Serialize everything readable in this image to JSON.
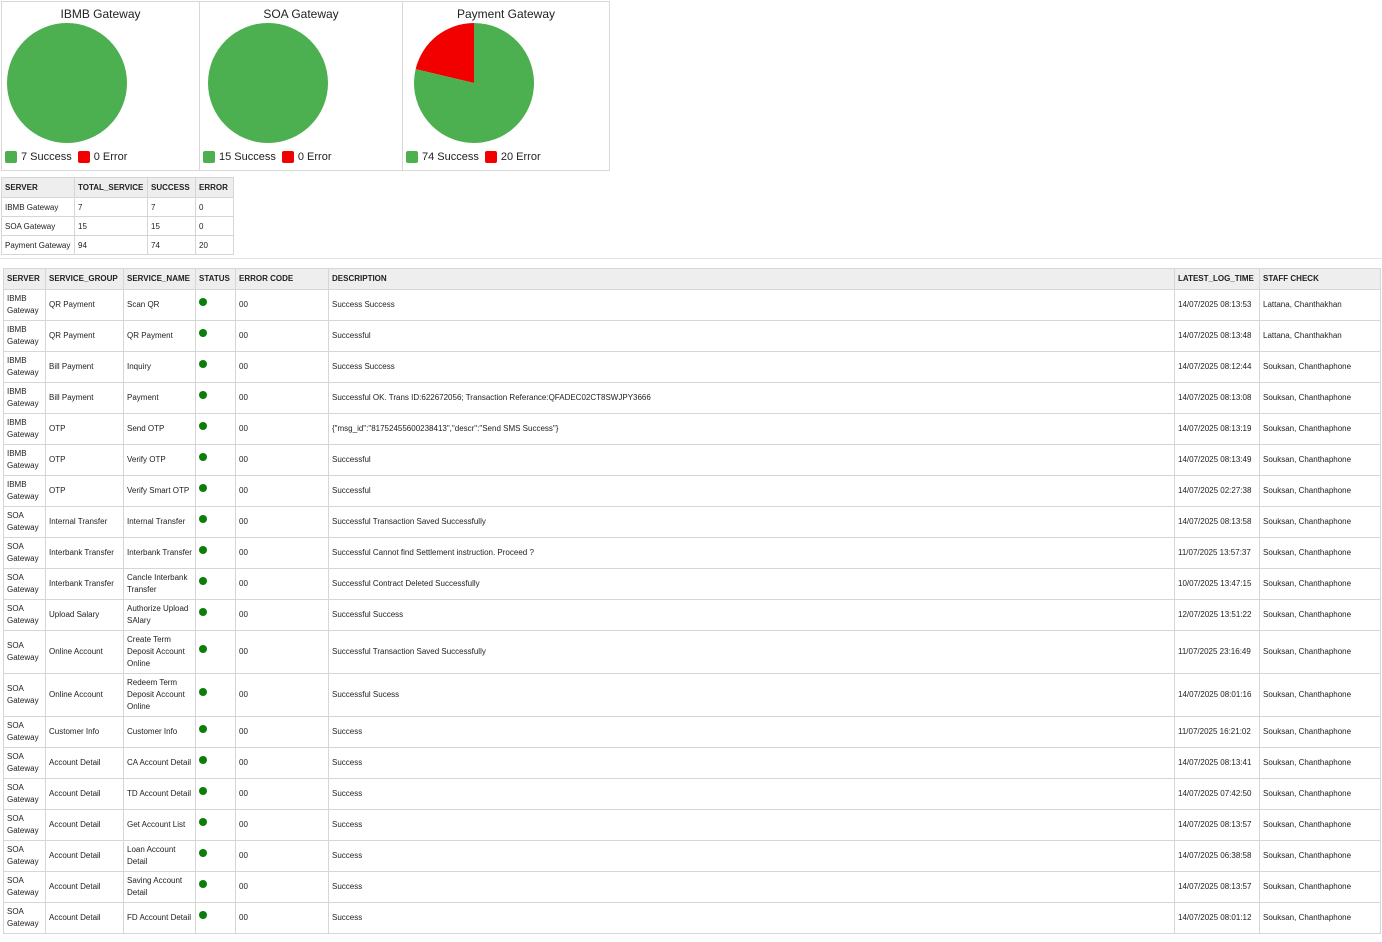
{
  "colors": {
    "success": "#4caf50",
    "error": "#f20000",
    "status_ok": "#0a7d0a",
    "header_bg": "#eeeeee"
  },
  "charts": [
    {
      "title": "IBMB Gateway",
      "success": 7,
      "error": 0,
      "success_label": "7 Success",
      "error_label": "0 Error"
    },
    {
      "title": "SOA Gateway",
      "success": 15,
      "error": 0,
      "success_label": "15 Success",
      "error_label": "0 Error"
    },
    {
      "title": "Payment Gateway",
      "success": 74,
      "error": 20,
      "success_label": "74 Success",
      "error_label": "20 Error"
    }
  ],
  "summary": {
    "headers": [
      "SERVER",
      "TOTAL_SERVICE",
      "SUCCESS",
      "ERROR"
    ],
    "rows": [
      [
        "IBMB Gateway",
        "7",
        "7",
        "0"
      ],
      [
        "SOA Gateway",
        "15",
        "15",
        "0"
      ],
      [
        "Payment Gateway",
        "94",
        "74",
        "20"
      ]
    ]
  },
  "detail": {
    "headers": [
      "SERVER",
      "SERVICE_GROUP",
      "SERVICE_NAME",
      "STATUS",
      "ERROR CODE",
      "DESCRIPTION",
      "LATEST_LOG_TIME",
      "STAFF CHECK"
    ],
    "rows": [
      {
        "server": "IBMB Gateway",
        "group": "QR Payment",
        "name": "Scan QR",
        "status": "ok",
        "code": "00",
        "desc": "Success Success",
        "time": "14/07/2025 08:13:53",
        "staff": "Lattana, Chanthakhan"
      },
      {
        "server": "IBMB Gateway",
        "group": "QR Payment",
        "name": "QR Payment",
        "status": "ok",
        "code": "00",
        "desc": "Successful",
        "time": "14/07/2025 08:13:48",
        "staff": "Lattana, Chanthakhan"
      },
      {
        "server": "IBMB Gateway",
        "group": "Bill Payment",
        "name": "Inquiry",
        "status": "ok",
        "code": "00",
        "desc": "Success Success",
        "time": "14/07/2025 08:12:44",
        "staff": "Souksan, Chanthaphone"
      },
      {
        "server": "IBMB Gateway",
        "group": "Bill Payment",
        "name": "Payment",
        "status": "ok",
        "code": "00",
        "desc": "Successful OK. Trans ID:622672056; Transaction Referance:QFADEC02CT8SWJPY3666",
        "time": "14/07/2025 08:13:08",
        "staff": "Souksan, Chanthaphone"
      },
      {
        "server": "IBMB Gateway",
        "group": "OTP",
        "name": "Send OTP",
        "status": "ok",
        "code": "00",
        "desc": "{\"msg_id\":\"81752455600238413\",\"descr\":\"Send SMS Success\"}",
        "time": "14/07/2025 08:13:19",
        "staff": "Souksan, Chanthaphone"
      },
      {
        "server": "IBMB Gateway",
        "group": "OTP",
        "name": "Verify OTP",
        "status": "ok",
        "code": "00",
        "desc": "Successful",
        "time": "14/07/2025 08:13:49",
        "staff": "Souksan, Chanthaphone"
      },
      {
        "server": "IBMB Gateway",
        "group": "OTP",
        "name": "Verify Smart OTP",
        "status": "ok",
        "code": "00",
        "desc": "Successful",
        "time": "14/07/2025 02:27:38",
        "staff": "Souksan, Chanthaphone"
      },
      {
        "server": "SOA Gateway",
        "group": "Internal Transfer",
        "name": "Internal Transfer",
        "status": "ok",
        "code": "00",
        "desc": "Successful Transaction Saved Successfully",
        "time": "14/07/2025 08:13:58",
        "staff": "Souksan, Chanthaphone"
      },
      {
        "server": "SOA Gateway",
        "group": "Interbank Transfer",
        "name": "Interbank Transfer",
        "status": "ok",
        "code": "00",
        "desc": "Successful Cannot find Settlement instruction. Proceed ?",
        "time": "11/07/2025 13:57:37",
        "staff": "Souksan, Chanthaphone"
      },
      {
        "server": "SOA Gateway",
        "group": "Interbank Transfer",
        "name": "Cancle Interbank Transfer",
        "status": "ok",
        "code": "00",
        "desc": "Successful Contract Deleted Successfully",
        "time": "10/07/2025 13:47:15",
        "staff": "Souksan, Chanthaphone"
      },
      {
        "server": "SOA Gateway",
        "group": "Upload Salary",
        "name": "Authorize Upload SAlary",
        "status": "ok",
        "code": "00",
        "desc": "Successful Success",
        "time": "12/07/2025 13:51:22",
        "staff": "Souksan, Chanthaphone"
      },
      {
        "server": "SOA Gateway",
        "group": "Online Account",
        "name": "Create Term Deposit Account Online",
        "status": "ok",
        "code": "00",
        "desc": "Successful Transaction Saved Successfully",
        "time": "11/07/2025 23:16:49",
        "staff": "Souksan, Chanthaphone"
      },
      {
        "server": "SOA Gateway",
        "group": "Online Account",
        "name": "Redeem Term Deposit Account Online",
        "status": "ok",
        "code": "00",
        "desc": "Successful Sucess",
        "time": "14/07/2025 08:01:16",
        "staff": "Souksan, Chanthaphone"
      },
      {
        "server": "SOA Gateway",
        "group": "Customer Info",
        "name": "Customer Info",
        "status": "ok",
        "code": "00",
        "desc": "Success",
        "time": "11/07/2025 16:21:02",
        "staff": "Souksan, Chanthaphone"
      },
      {
        "server": "SOA Gateway",
        "group": "Account Detail",
        "name": "CA Account Detail",
        "status": "ok",
        "code": "00",
        "desc": "Success",
        "time": "14/07/2025 08:13:41",
        "staff": "Souksan, Chanthaphone"
      },
      {
        "server": "SOA Gateway",
        "group": "Account Detail",
        "name": "TD Account Detail",
        "status": "ok",
        "code": "00",
        "desc": "Success",
        "time": "14/07/2025 07:42:50",
        "staff": "Souksan, Chanthaphone"
      },
      {
        "server": "SOA Gateway",
        "group": "Account Detail",
        "name": "Get Account List",
        "status": "ok",
        "code": "00",
        "desc": "Success",
        "time": "14/07/2025 08:13:57",
        "staff": "Souksan, Chanthaphone"
      },
      {
        "server": "SOA Gateway",
        "group": "Account Detail",
        "name": "Loan Account Detail",
        "status": "ok",
        "code": "00",
        "desc": "Success",
        "time": "14/07/2025 06:38:58",
        "staff": "Souksan, Chanthaphone"
      },
      {
        "server": "SOA Gateway",
        "group": "Account Detail",
        "name": "Saving Account Detail",
        "status": "ok",
        "code": "00",
        "desc": "Success",
        "time": "14/07/2025 08:13:57",
        "staff": "Souksan, Chanthaphone"
      },
      {
        "server": "SOA Gateway",
        "group": "Account Detail",
        "name": "FD Account Detail",
        "status": "ok",
        "code": "00",
        "desc": "Success",
        "time": "14/07/2025 08:01:12",
        "staff": "Souksan, Chanthaphone"
      }
    ]
  }
}
